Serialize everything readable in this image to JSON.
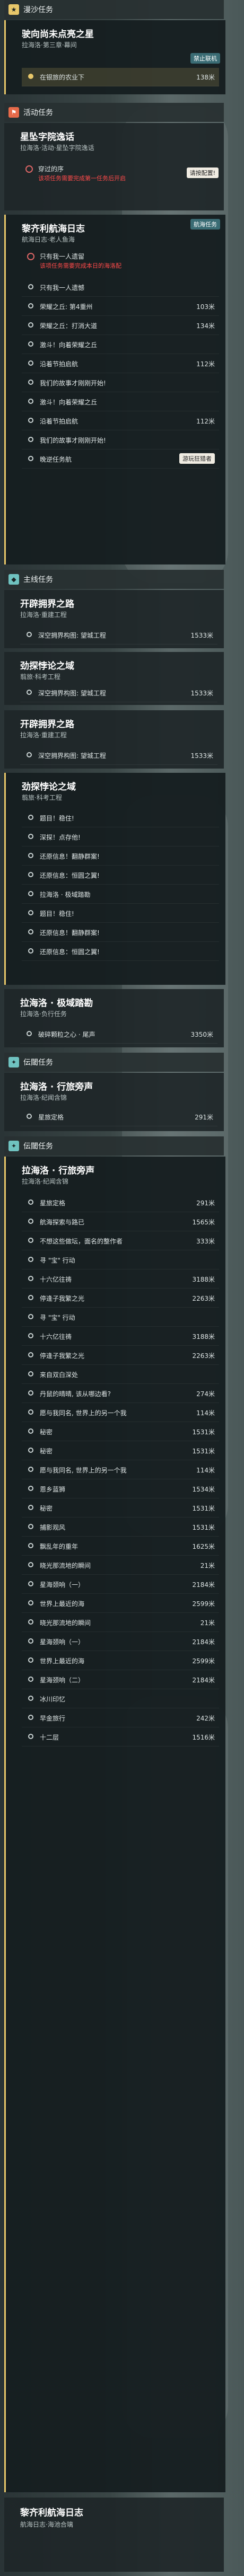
{
  "top_header": {
    "label": "漫沙任务"
  },
  "s1": {
    "title": "驶向尚未点亮之星",
    "subtitle": "拉海洛·第三章·幕间",
    "item": "在银旅的农业下",
    "dist": "138米",
    "badge": "禁止联机"
  },
  "activity_header": {
    "label": "活动任务"
  },
  "s2": {
    "title": "星坠字院逸话",
    "subtitle": "拉海洛·活动·星坠字院逸话",
    "item": "穿过的序",
    "badge": "请按配置!",
    "warn_red": "该项任务需要完成第一任务后开启"
  },
  "s3": {
    "title": "黎齐利航海日志",
    "subtitle": "航海日志·老人鱼海",
    "badge": "航海任务",
    "warn_text": "只有我一人遗留",
    "warn_red": "该项任务需要完成本日的海洛配",
    "items": [
      {
        "label": "只有我一人遗憾",
        "dist": ""
      },
      {
        "label": "荣耀之丘: 第4重州",
        "dist": "103米"
      },
      {
        "label": "荣耀之丘：打消大道",
        "dist": "134米"
      },
      {
        "label": "激斗！向着荣耀之丘",
        "dist": ""
      },
      {
        "label": "沿着节拍启航",
        "dist": "112米"
      },
      {
        "label": "我们的故事才刚刚开始!",
        "dist": ""
      },
      {
        "label": "激斗！向着荣耀之丘",
        "dist": ""
      },
      {
        "label": "沿着节拍启航",
        "dist": "112米"
      },
      {
        "label": "我们的故事才刚刚开始!",
        "dist": ""
      },
      {
        "label": "晚逆任务航",
        "dist": "",
        "badge": "游玩狂猎者"
      }
    ]
  },
  "story_header": {
    "label": "主线任务"
  },
  "s4": {
    "title": "开辟拥界之路",
    "subtitle": "拉海洛·重建工程",
    "item": "深空拥界构图: 望城工程",
    "dist": "1533米"
  },
  "s5": {
    "title": "劲探悖论之域",
    "subtitle": "翦旅·科考工程",
    "items": [
      {
        "label": "深空拥界构图: 望城工程",
        "dist": "1533米"
      }
    ]
  },
  "s6": {
    "title": "开辟拥界之路",
    "subtitle": "拉海洛·重建工程",
    "item": "深空拥界构图: 望城工程",
    "dist": "1533米"
  },
  "s7": {
    "title": "劲探悖论之域",
    "subtitle": "翦旅·科考工程",
    "items": [
      {
        "label": "题目！稳住!",
        "dist": ""
      },
      {
        "label": "深探！点存他!",
        "dist": ""
      },
      {
        "label": "还原信息！翻静群案!",
        "dist": ""
      },
      {
        "label": "还原信息：恒圆之翼!",
        "dist": ""
      },
      {
        "label": "拉海洛 · 极域踏勘",
        "dist": ""
      },
      {
        "label": "题目！稳住!",
        "dist": ""
      },
      {
        "label": "还原信息！翻静群案!",
        "dist": ""
      },
      {
        "label": "还原信息：恒圆之翼!",
        "dist": ""
      }
    ]
  },
  "s8": {
    "title": "拉海洛 · 极域踏勘",
    "subtitle": "拉海洛·负行任务",
    "item": "破碎颗粒之心 · 尾声",
    "dist": "3350米"
  },
  "side_header": {
    "label": "伝閾任务"
  },
  "s9": {
    "title": "拉海洛 · 行旅旁声",
    "subtitle": "拉海洛·纪闻含锦",
    "items": [
      {
        "label": "星旅定格",
        "dist": "291米"
      }
    ]
  },
  "side_header2": {
    "label": "伝閾任务"
  },
  "s10": {
    "title": "拉海洛 · 行旅旁声",
    "subtitle": "拉海洛·纪闻含锦",
    "items": [
      {
        "label": "星旅定格",
        "dist": "291米"
      },
      {
        "label": "航海探索与路已",
        "dist": "1565米"
      },
      {
        "label": "不想这些做坛，面名的整作者",
        "dist": "333米"
      },
      {
        "label": "寻 \"宝\" 行动",
        "dist": ""
      },
      {
        "label": "十六亿往祷",
        "dist": "3188米"
      },
      {
        "label": "停逢子我繁之光",
        "dist": "2263米"
      },
      {
        "label": "寻 \"宝\" 行动",
        "dist": ""
      },
      {
        "label": "十六亿往祷",
        "dist": "3188米"
      },
      {
        "label": "停逢子我繁之光",
        "dist": "2263米"
      },
      {
        "label": "来自双白深处",
        "dist": ""
      },
      {
        "label": "丹鼠的晴晴, 该从哪边看?",
        "dist": "274米"
      },
      {
        "label": "愿与我同名, 世界上的另一个我",
        "dist": "114米"
      },
      {
        "label": "秘密",
        "dist": "1531米"
      },
      {
        "label": "秘密",
        "dist": "1531米"
      },
      {
        "label": "愿与我同名, 世界上的另一个我",
        "dist": "114米"
      },
      {
        "label": "恩乡蓝狮",
        "dist": "1534米"
      },
      {
        "label": "秘密",
        "dist": "1531米"
      },
      {
        "label": "捕影观风",
        "dist": "1531米"
      },
      {
        "label": "飘乱年的重年",
        "dist": "1625米"
      },
      {
        "label": "晓光那流地的瞬间",
        "dist": "21米"
      },
      {
        "label": "星海颈响（一）",
        "dist": "2184米"
      },
      {
        "label": "世界上最近的海",
        "dist": "2599米"
      },
      {
        "label": "晓光那流地的瞬间",
        "dist": "21米"
      },
      {
        "label": "星海颈响（一）",
        "dist": "2184米"
      },
      {
        "label": "世界上最近的海",
        "dist": "2599米"
      },
      {
        "label": "星海颈响（二）",
        "dist": "2184米"
      },
      {
        "label": "冰川印忆",
        "dist": ""
      },
      {
        "label": "早金旅行",
        "dist": "242米"
      },
      {
        "label": "十二层",
        "dist": "1516米"
      }
    ]
  },
  "s11": {
    "title": "黎齐利航海日志",
    "subtitle": "航海日志·海池合璃"
  }
}
